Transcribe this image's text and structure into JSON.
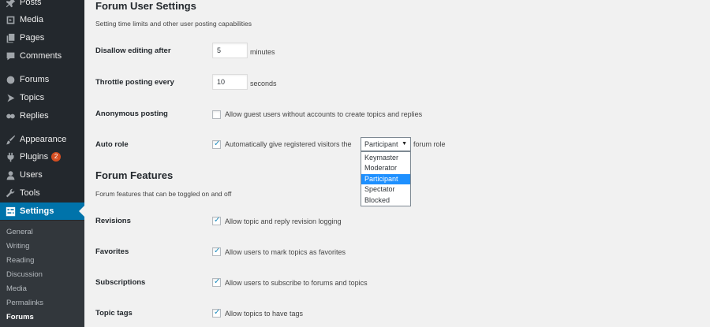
{
  "sidebar": {
    "items": [
      {
        "label": "Posts",
        "icon": "pin-icon"
      },
      {
        "label": "Media",
        "icon": "media-icon"
      },
      {
        "label": "Pages",
        "icon": "pages-icon"
      },
      {
        "label": "Comments",
        "icon": "comments-icon"
      },
      {
        "label": "Forums",
        "icon": "forums-icon"
      },
      {
        "label": "Topics",
        "icon": "topics-icon"
      },
      {
        "label": "Replies",
        "icon": "replies-icon"
      },
      {
        "label": "Appearance",
        "icon": "brush-icon"
      },
      {
        "label": "Plugins",
        "icon": "plug-icon",
        "badge": "2"
      },
      {
        "label": "Users",
        "icon": "user-icon"
      },
      {
        "label": "Tools",
        "icon": "wrench-icon"
      },
      {
        "label": "Settings",
        "icon": "settings-icon"
      }
    ],
    "submenu": [
      "General",
      "Writing",
      "Reading",
      "Discussion",
      "Media",
      "Permalinks",
      "Forums"
    ],
    "colors": {
      "bg": "#23282d",
      "active": "#0073aa",
      "submenu_bg": "#32373c"
    }
  },
  "user_settings": {
    "title": "Forum User Settings",
    "description": "Setting time limits and other user posting capabilities",
    "disallow": {
      "label": "Disallow editing after",
      "value": "5",
      "unit": "minutes"
    },
    "throttle": {
      "label": "Throttle posting every",
      "value": "10",
      "unit": "seconds"
    },
    "anonymous": {
      "label": "Anonymous posting",
      "checkbox_label": "Allow guest users without accounts to create topics and replies",
      "checked": false
    },
    "auto_role": {
      "label": "Auto role",
      "checkbox_label": "Automatically give registered visitors the",
      "after_label": "forum role",
      "checked": true,
      "selected": "Participant",
      "options": [
        "Keymaster",
        "Moderator",
        "Participant",
        "Spectator",
        "Blocked"
      ]
    }
  },
  "features": {
    "title": "Forum Features",
    "description": "Forum features that can be toggled on and off",
    "revisions": {
      "label": "Revisions",
      "checkbox_label": "Allow topic and reply revision logging",
      "checked": true
    },
    "favorites": {
      "label": "Favorites",
      "checkbox_label": "Allow users to mark topics as favorites",
      "checked": true
    },
    "subscriptions": {
      "label": "Subscriptions",
      "checkbox_label": "Allow users to subscribe to forums and topics",
      "checked": true
    },
    "topic_tags": {
      "label": "Topic tags",
      "checkbox_label": "Allow topics to have tags",
      "checked": true
    }
  },
  "check_glyph": "✓"
}
